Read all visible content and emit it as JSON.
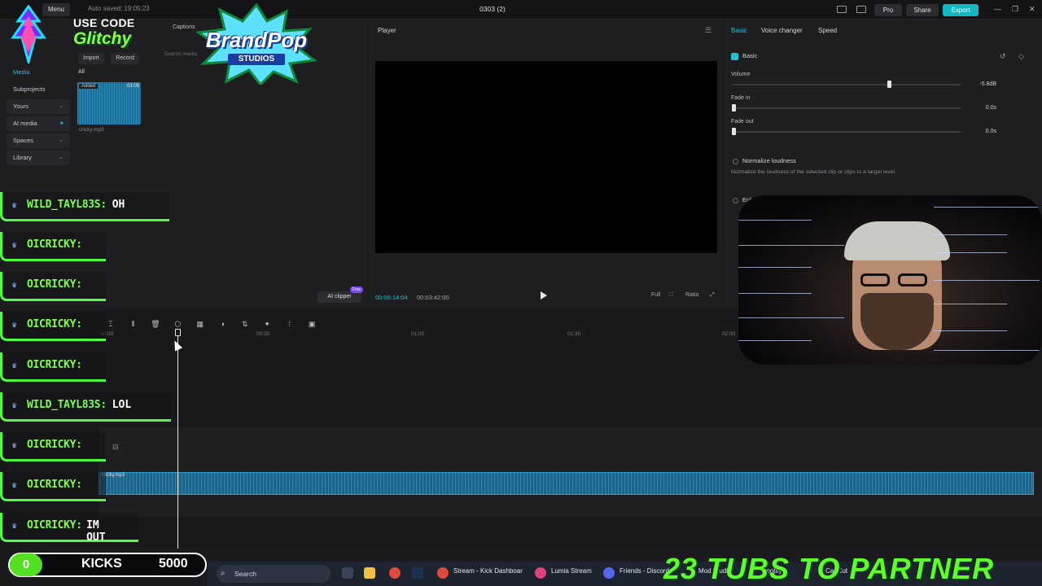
{
  "topbar": {
    "menu": "Menu",
    "autosave": "Auto saved: 19:05:23",
    "title": "0303 (2)",
    "pro": "Pro",
    "share": "Share",
    "export": "Export"
  },
  "media": {
    "captions_tab": "Captions",
    "nav": [
      {
        "label": "Media"
      },
      {
        "label": "Subprojects"
      },
      {
        "label": "Yours"
      },
      {
        "label": "AI media"
      },
      {
        "label": "Spaces"
      },
      {
        "label": "Library"
      }
    ],
    "import": "Import",
    "record": "Record",
    "search_placeholder": "Search media",
    "filter_all": "All",
    "clip": {
      "added": "Added",
      "duration": "03:09",
      "name": "cricky.mp3"
    },
    "ai_clipper": "AI clipper",
    "free_badge": "Free"
  },
  "player": {
    "label": "Player",
    "current_time": "00:00:14:04",
    "total_time": "00:03:42:00",
    "ratio": "Ratio",
    "full": "Full"
  },
  "inspector": {
    "tabs": [
      "Basic",
      "Voice changer",
      "Speed"
    ],
    "basic_head": "Basic",
    "volume_label": "Volume",
    "volume_value": "-5.8dB",
    "volume_level": 0.68,
    "fadein_label": "Fade in",
    "fadein_value": "0.0s",
    "fadeout_label": "Fade out",
    "fadeout_value": "0.0s",
    "normalize_label": "Normalize loudness",
    "normalize_desc": "Normalize the loudness of the selected clip or clips to a target level.",
    "enhance_label": "Enhan"
  },
  "timeline": {
    "ruler": [
      "00:00",
      "00:30",
      "01:00",
      "01:30",
      "02:00"
    ],
    "track_name": "cricky.mp3"
  },
  "overlay": {
    "use_code": "USE CODE",
    "code": "Glitchy",
    "brand_line1": "BrandPop",
    "brand_line2": "STUDIOS",
    "chat": [
      {
        "user": "WILD_TAYL83S:",
        "msg": "OH"
      },
      {
        "user": "OICRICKY:",
        "msg": ""
      },
      {
        "user": "OICRICKY:",
        "msg": ""
      },
      {
        "user": "OICRICKY:",
        "msg": ""
      },
      {
        "user": "OICRICKY:",
        "msg": ""
      },
      {
        "user": "WILD_TAYL83S:",
        "msg": "LOL"
      },
      {
        "user": "OICRICKY:",
        "msg": ""
      },
      {
        "user": "OICRICKY:",
        "msg": ""
      },
      {
        "user": "OICRICKY:",
        "msg": "IM OUT"
      }
    ],
    "kicks_count": "0",
    "kicks_label": "KICKS",
    "kicks_goal": "5000",
    "partner_text": "23 TUBS TO PARTNER"
  },
  "taskbar": {
    "search": "Search",
    "apps": [
      "Stream - Kick Dashboar",
      "Lumia Stream",
      "Friends - Discord",
      "Mod Studio",
      "Spotify",
      "CapCut"
    ]
  },
  "colors": {
    "accent": "#1fc3d0",
    "chat_green": "#7dff4a",
    "export": "#11b8c4"
  }
}
